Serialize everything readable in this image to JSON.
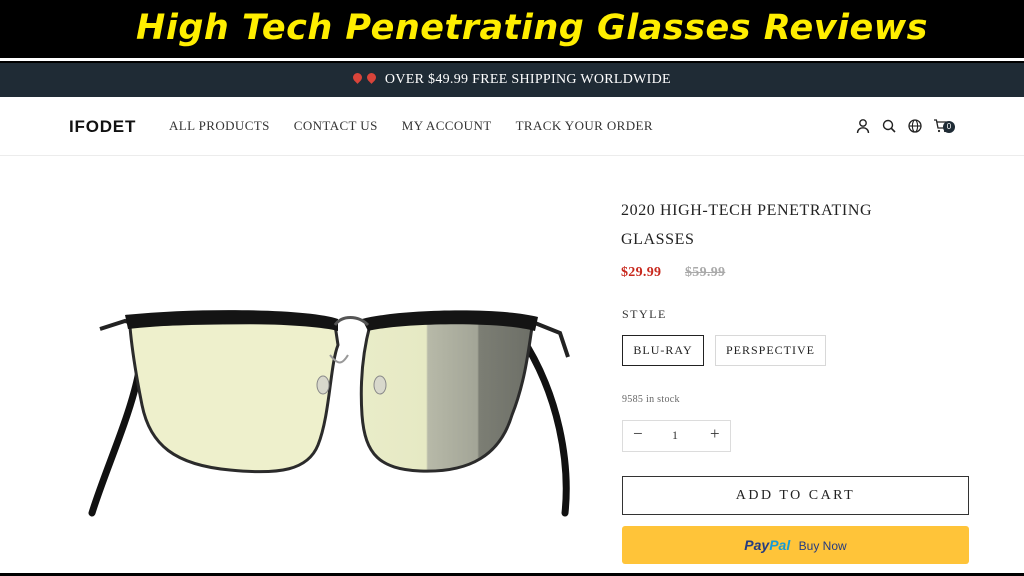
{
  "banner": {
    "title": "High Tech Penetrating Glasses Reviews"
  },
  "shipping_bar": {
    "text": "OVER $49.99 FREE SHIPPING WORLDWIDE"
  },
  "header": {
    "logo": "IFODET",
    "nav": [
      "ALL PRODUCTS",
      "CONTACT US",
      "MY ACCOUNT",
      "TRACK YOUR ORDER"
    ],
    "icons": [
      "user-icon",
      "search-icon",
      "globe-icon",
      "cart-icon"
    ],
    "cart_count": "0"
  },
  "product": {
    "title": "2020 HIGH-TECH PENETRATING GLASSES",
    "price": "$29.99",
    "compare_price": "$59.99",
    "style_label": "STYLE",
    "style_options": [
      "BLU-RAY",
      "PERSPECTIVE"
    ],
    "selected_style": "BLU-RAY",
    "stock": "9585 in stock",
    "quantity": "1",
    "add_to_cart": "ADD TO CART",
    "paypal": {
      "brand_pay": "Pay",
      "brand_pal": "Pal",
      "label": "Buy Now"
    }
  },
  "colors": {
    "accent_yellow": "#ffee00",
    "price_red": "#c8281d",
    "topbar": "#1f2b35",
    "paypal_yellow": "#ffc439"
  }
}
